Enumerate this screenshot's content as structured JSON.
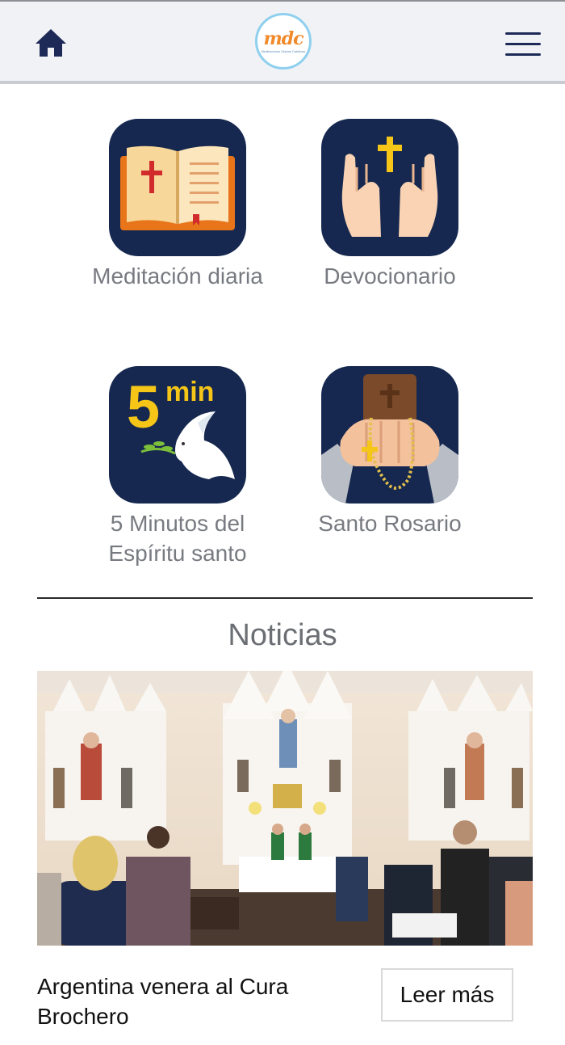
{
  "header": {
    "home_icon": "home-icon",
    "logo_text": "mdc",
    "logo_subtext": "Meditaciones Diarias Católicas",
    "menu_icon": "hamburger-menu-icon",
    "colors": {
      "background": "#f1f2f5",
      "icon": "#1d2a57",
      "logo_accent": "#f08a2a",
      "logo_ring": "#8fd0ee"
    }
  },
  "tiles": [
    {
      "label": "Meditación diaria",
      "icon": "open-bible-icon"
    },
    {
      "label": "Devocionario",
      "icon": "praying-hands-icon"
    },
    {
      "label": "5 Minutos del Espíritu santo",
      "icon": "dove-5min-icon",
      "icon_text_number": "5",
      "icon_text_unit": "min"
    },
    {
      "label": "Santo Rosario",
      "icon": "rosary-hands-icon"
    }
  ],
  "news": {
    "section_title": "Noticias",
    "image": "church-mass-photo",
    "headline": "Argentina venera al Cura Brochero",
    "read_more_label": "Leer más"
  },
  "colors": {
    "tile_background": "#16284f",
    "label_text": "#777a80",
    "accent_gold": "#f5c518"
  }
}
